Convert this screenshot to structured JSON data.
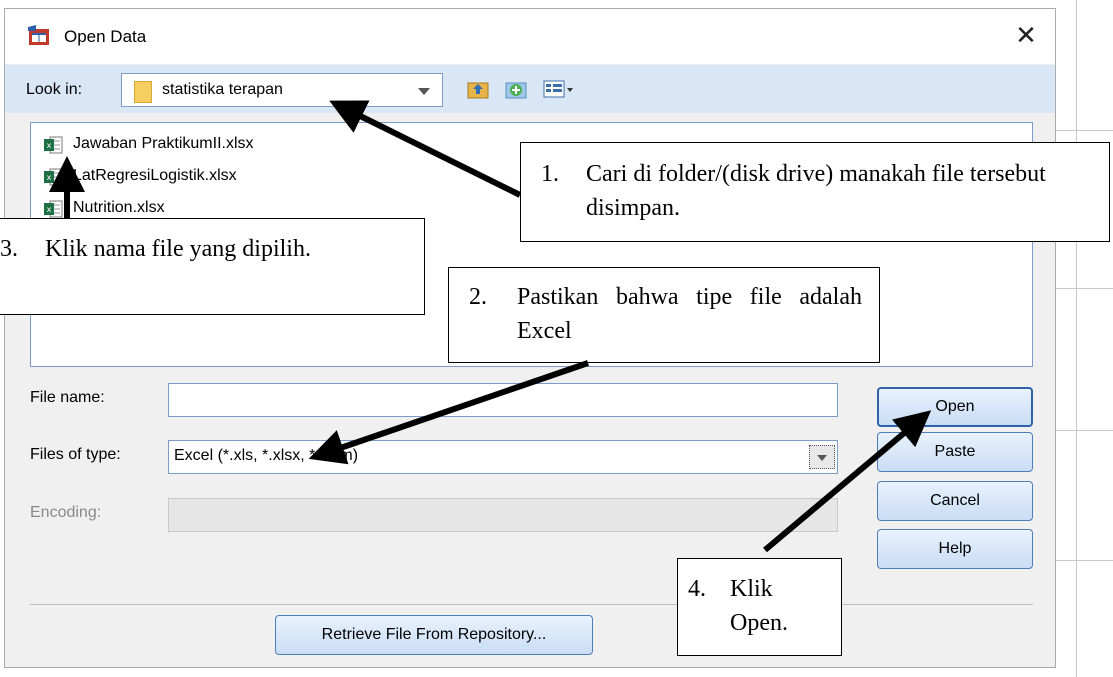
{
  "dialog": {
    "title": "Open Data",
    "close_glyph": "✕",
    "look_in_label": "Look in:",
    "look_in_value": "statistika terapan",
    "files": [
      {
        "name": "Jawaban PraktikumII.xlsx",
        "icon": "excel-file-icon"
      },
      {
        "name": "LatRegresiLogistik.xlsx",
        "icon": "excel-file-icon"
      },
      {
        "name": "Nutrition.xlsx",
        "icon": "excel-file-icon"
      }
    ],
    "file_name_label": "File name:",
    "file_name_value": "",
    "files_of_type_label": "Files of type:",
    "files_of_type_value": "Excel (*.xls, *.xlsx, *.xlsm)",
    "encoding_label": "Encoding:",
    "encoding_value": "",
    "buttons": {
      "open": "Open",
      "paste": "Paste",
      "cancel": "Cancel",
      "help": "Help",
      "retrieve": "Retrieve File From Repository..."
    }
  },
  "annotations": {
    "a1": {
      "number": "1.",
      "text": "Cari di folder/(disk drive) manakah file tersebut disimpan."
    },
    "a2": {
      "number": "2.",
      "text": "Pastikan bahwa tipe file adalah Excel"
    },
    "a3": {
      "number": "3.",
      "text": "Klik nama file yang dipilih."
    },
    "a4": {
      "number": "4.",
      "text": "Klik Open."
    }
  },
  "colors": {
    "dialog_bg": "#f0f0f0",
    "lookin_bar": "#d9e6f5",
    "button_border": "#4f7dba",
    "arrow": "#000000"
  }
}
